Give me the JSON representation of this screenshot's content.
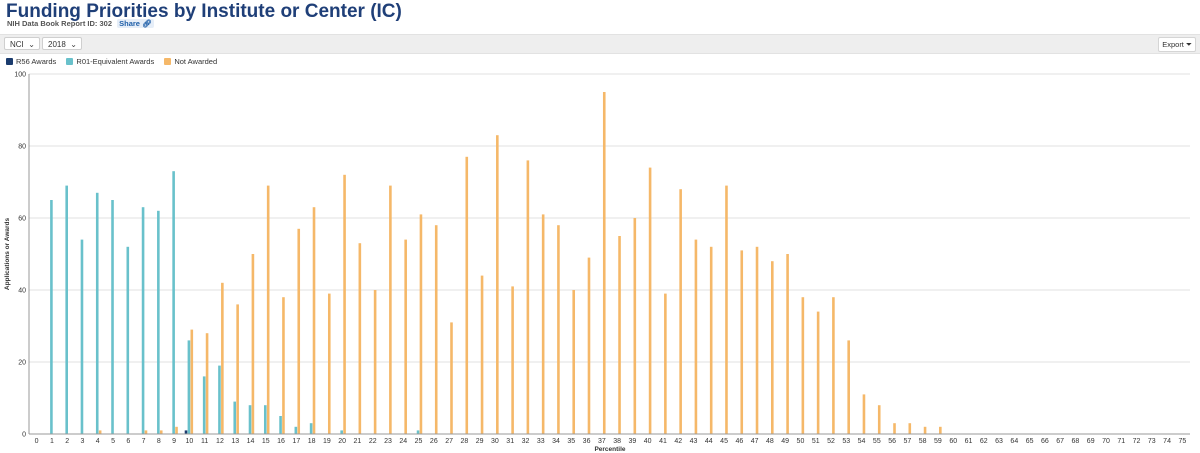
{
  "header": {
    "title": "Funding Priorities by Institute or Center (IC)",
    "report_id": "NIH Data Book Report ID: 302",
    "share_label": "Share",
    "share_icon": "link-icon"
  },
  "filters": {
    "ic": "NCI",
    "year": "2018",
    "chevron_icon": "chevron-down-icon"
  },
  "export_label": "Export",
  "export_icon": "filter-icon",
  "colors": {
    "r56": "#1b3c6e",
    "r01": "#69c1cb",
    "not_awarded": "#f5b869",
    "grid": "#e0e0e0",
    "title": "#1f3f78"
  },
  "chart_data": {
    "type": "bar",
    "xlabel": "Percentile",
    "ylabel": "Applications or Awards",
    "ylim": [
      0,
      100
    ],
    "yticks": [
      0,
      20,
      40,
      60,
      80,
      100
    ],
    "grid": true,
    "legend_position": "top-left",
    "categories": [
      "0",
      "1",
      "2",
      "3",
      "4",
      "5",
      "6",
      "7",
      "8",
      "9",
      "10",
      "11",
      "12",
      "13",
      "14",
      "15",
      "16",
      "17",
      "18",
      "19",
      "20",
      "21",
      "22",
      "23",
      "24",
      "25",
      "26",
      "27",
      "28",
      "29",
      "30",
      "31",
      "32",
      "33",
      "34",
      "35",
      "36",
      "37",
      "38",
      "39",
      "40",
      "41",
      "42",
      "43",
      "44",
      "45",
      "46",
      "47",
      "48",
      "49",
      "50",
      "51",
      "52",
      "53",
      "54",
      "55",
      "56",
      "57",
      "58",
      "59",
      "60",
      "61",
      "62",
      "63",
      "64",
      "65",
      "66",
      "67",
      "68",
      "69",
      "70",
      "71",
      "72",
      "73",
      "74",
      "75"
    ],
    "series": [
      {
        "name": "R56 Awards",
        "color": "#1b3c6e",
        "values": [
          0,
          0,
          0,
          0,
          0,
          0,
          0,
          0,
          0,
          0,
          1,
          0,
          0,
          0,
          0,
          0,
          0,
          0,
          0,
          0,
          0,
          0,
          0,
          0,
          0,
          0,
          0,
          0,
          0,
          0,
          0,
          0,
          0,
          0,
          0,
          0,
          0,
          0,
          0,
          0,
          0,
          0,
          0,
          0,
          0,
          0,
          0,
          0,
          0,
          0,
          0,
          0,
          0,
          0,
          0,
          0,
          0,
          0,
          0,
          0,
          0,
          0,
          0,
          0,
          0,
          0,
          0,
          0,
          0,
          0,
          0,
          0,
          0,
          0,
          0,
          0
        ]
      },
      {
        "name": "R01-Equivalent Awards",
        "color": "#69c1cb",
        "values": [
          0,
          65,
          69,
          54,
          67,
          65,
          52,
          63,
          62,
          73,
          26,
          16,
          19,
          9,
          8,
          8,
          5,
          2,
          3,
          0,
          1,
          0,
          0,
          0,
          0,
          1,
          0,
          0,
          0,
          0,
          0,
          0,
          0,
          0,
          0,
          0,
          0,
          0,
          0,
          0,
          0,
          0,
          0,
          0,
          0,
          0,
          0,
          0,
          0,
          0,
          0,
          0,
          0,
          0,
          0,
          0,
          0,
          0,
          0,
          0,
          0,
          0,
          0,
          0,
          0,
          0,
          0,
          0,
          0,
          0,
          0,
          0,
          0,
          0,
          0,
          0
        ]
      },
      {
        "name": "Not Awarded",
        "color": "#f5b869",
        "values": [
          0,
          0,
          0,
          0,
          1,
          0,
          0,
          1,
          1,
          2,
          29,
          28,
          42,
          36,
          50,
          69,
          38,
          57,
          63,
          39,
          72,
          53,
          40,
          69,
          54,
          61,
          58,
          31,
          77,
          44,
          83,
          41,
          76,
          61,
          58,
          40,
          49,
          95,
          55,
          60,
          74,
          39,
          68,
          54,
          52,
          69,
          51,
          52,
          48,
          50,
          38,
          34,
          38,
          26,
          11,
          8,
          3,
          3,
          2,
          2,
          0,
          0,
          0,
          0,
          0,
          0,
          0,
          0,
          0,
          0,
          0,
          0,
          0,
          0,
          0,
          0
        ]
      }
    ]
  }
}
